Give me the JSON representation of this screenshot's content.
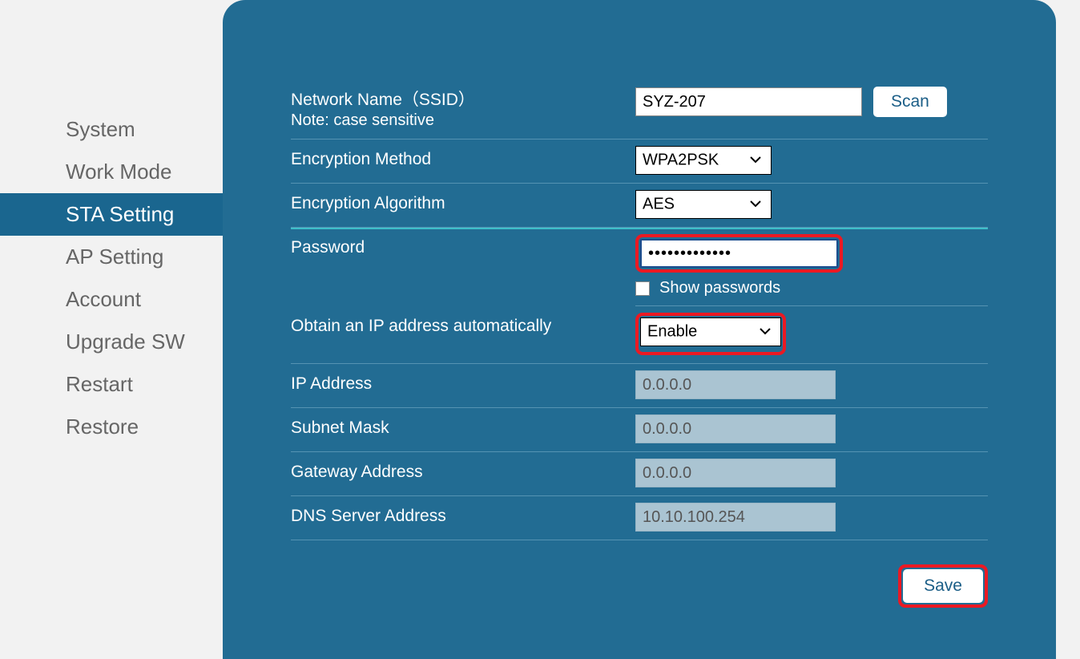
{
  "sidebar": {
    "items": [
      {
        "label": "System"
      },
      {
        "label": "Work Mode"
      },
      {
        "label": "STA Setting"
      },
      {
        "label": "AP Setting"
      },
      {
        "label": "Account"
      },
      {
        "label": "Upgrade SW"
      },
      {
        "label": "Restart"
      },
      {
        "label": "Restore"
      }
    ]
  },
  "form": {
    "ssid_label": "Network Name（SSID）",
    "ssid_note": "Note: case sensitive",
    "ssid_value": "SYZ-207",
    "scan_btn": "Scan",
    "enc_method_label": "Encryption Method",
    "enc_method_value": "WPA2PSK",
    "enc_algo_label": "Encryption Algorithm",
    "enc_algo_value": "AES",
    "password_label": "Password",
    "password_value": "•••••••••••••",
    "show_pw_label": "Show passwords",
    "dhcp_label": "Obtain an IP address automatically",
    "dhcp_value": "Enable",
    "ip_label": "IP Address",
    "ip_value": "0.0.0.0",
    "subnet_label": "Subnet Mask",
    "subnet_value": "0.0.0.0",
    "gateway_label": "Gateway Address",
    "gateway_value": "0.0.0.0",
    "dns_label": "DNS Server Address",
    "dns_value": "10.10.100.254",
    "save_btn": "Save"
  }
}
